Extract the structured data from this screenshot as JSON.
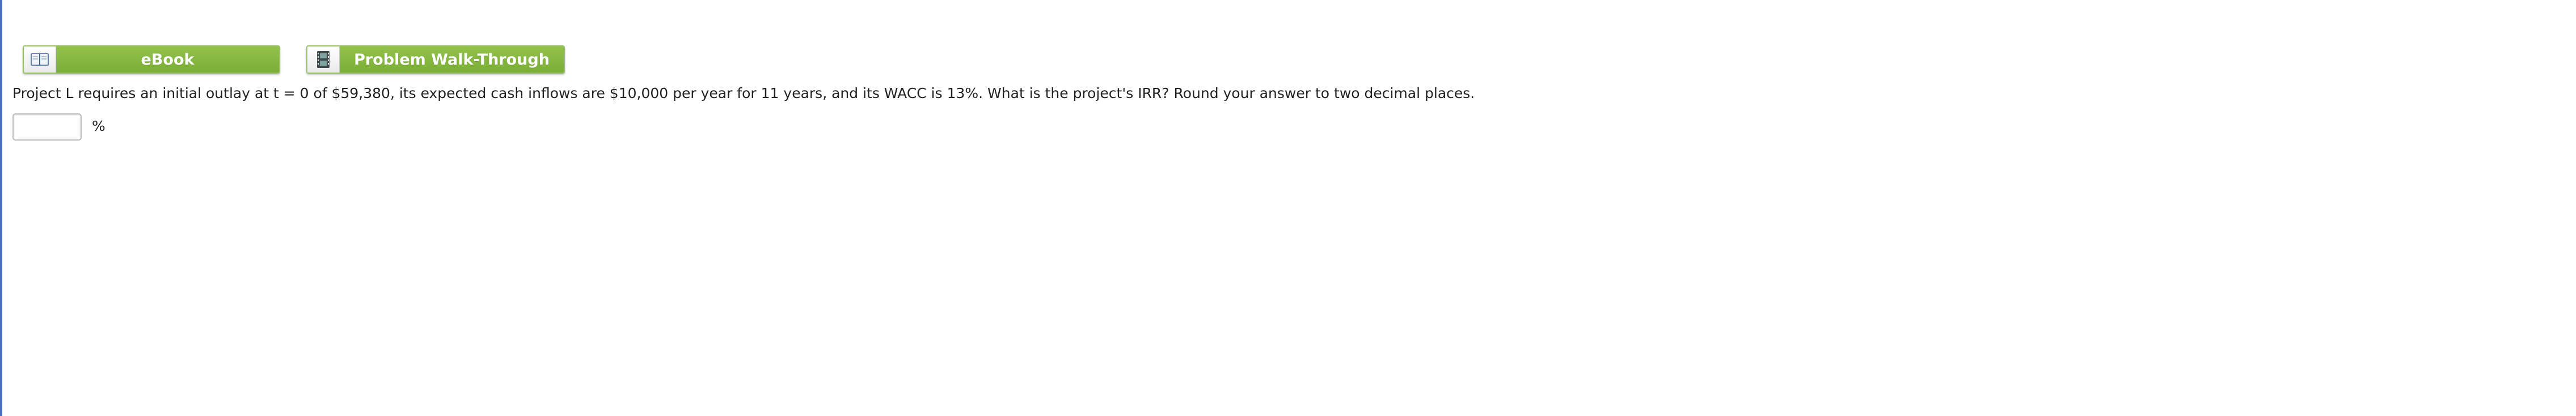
{
  "resources": {
    "ebook_label": "eBook",
    "ebook_icon": "book-icon",
    "walkthrough_label": "Problem Walk-Through",
    "walkthrough_icon": "film-icon",
    "accent_color": "#86b843"
  },
  "question": {
    "text": "Project L requires an initial outlay at t = 0 of $59,380, its expected cash inflows are $10,000 per year for 11 years, and its WACC is 13%. What is the project's IRR? Round your answer to two decimal places."
  },
  "answer": {
    "value": "",
    "unit": "%"
  }
}
